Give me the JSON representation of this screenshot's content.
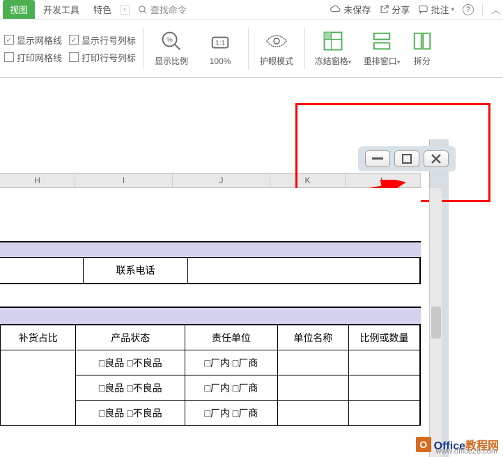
{
  "ribbon": {
    "tab_active": "视图",
    "tab_dev": "开发工具",
    "tab_special": "特色",
    "search_placeholder": "查找命令",
    "unsaved": "未保存",
    "share": "分享",
    "comments": "批注"
  },
  "toolbar": {
    "show_gridlines": "显示网格线",
    "print_gridlines": "打印网格线",
    "show_headers": "显示行号列标",
    "print_headers": "打印行号列标",
    "zoom": "显示比例",
    "hundred": "100%",
    "eye_mode": "护眼模式",
    "freeze": "冻结窗格",
    "arrange": "重排窗口",
    "split": "拆分"
  },
  "columns": [
    "H",
    "I",
    "J",
    "K",
    "L"
  ],
  "table": {
    "contact_label": "联系电话",
    "headers": [
      "补货占比",
      "产品状态",
      "责任单位",
      "单位名称",
      "比例或数量"
    ],
    "status_val": "□良品 □不良品",
    "resp_val": "□厂内 □厂商"
  },
  "watermark": {
    "brand1": "Office",
    "brand2": "教程网",
    "url": "www.office26.com"
  }
}
